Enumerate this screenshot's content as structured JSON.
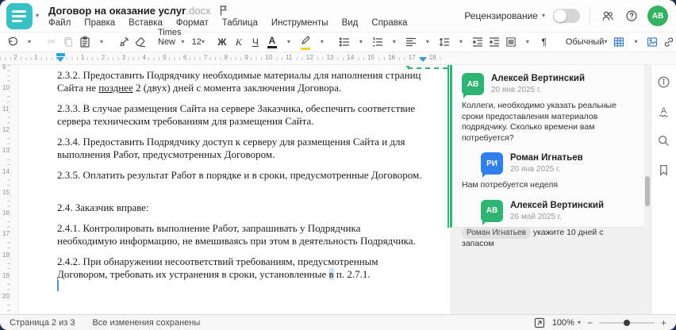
{
  "header": {
    "doc_title": "Договор на оказание услуг",
    "doc_ext": ".docx",
    "menu": [
      "Файл",
      "Правка",
      "Вставка",
      "Формат",
      "Таблица",
      "Инструменты",
      "Вид",
      "Справка"
    ],
    "review_label": "Рецензирование",
    "avatar_initials": "АВ"
  },
  "toolbar": {
    "font_name": "Times New ...",
    "font_size": "12",
    "bold_label": "Ж",
    "italic_label": "К",
    "underline_label": "Ч",
    "font_color_label": "А",
    "style_name": "Обычный",
    "pilcrow": "¶",
    "more_label": "···",
    "caret": "▾",
    "cut_glyph": "✂"
  },
  "ruler": {
    "h_left": [
      "2",
      "1"
    ],
    "h_right": [
      "1",
      "2",
      "3",
      "4",
      "5",
      "6",
      "7",
      "8",
      "9",
      "10",
      "11",
      "12",
      "13",
      "14",
      "15",
      "16",
      "17",
      "18"
    ],
    "v": [
      "9",
      "10",
      "11",
      "12",
      "13",
      "14",
      "15",
      "16",
      "17",
      "18",
      "19",
      "20"
    ]
  },
  "document": {
    "p232_a": "2.3.2. Предоставить Подрядчику необходимые материалы для наполнения страниц Сайта не ",
    "p232_u": "позднее",
    "p232_b": " 2 (двух) дней с момента заключения Договора.",
    "p233": "2.3.3. В случае размещения Сайта на сервере Заказчика, обеспечить соответствие сервера техническим требованиям для размещения Сайта.",
    "p234": "2.3.4. Предоставить Подрядчику доступ к серверу для размещения Сайта и для выполнения Работ, предусмотренных Договором.",
    "p235": "2.3.5. Оплатить результат Работ в порядке и в сроки, предусмотренные Договором.",
    "p24": "2.4. Заказчик вправе:",
    "p241": "2.4.1. Контролировать выполнение Работ, запрашивать у Подрядчика необходимую информацию, не вмешиваясь при этом в деятельность Подрядчика.",
    "p242_a": "2.4.2. При обнаружении несоответствий требованиям, предусмотренным Договором, требовать их устранения в сроки, установленные ",
    "p242_hl": "в",
    "p242_b": " п. 2.7.1."
  },
  "comments": {
    "thread": [
      {
        "initials": "АВ",
        "name": "Алексей Вертинский",
        "date": "20 янв 2025 г.",
        "text": "Коллеги, необходимо указать реальные сроки предоставления материалов подрядчику. Сколько времени вам потребуется?"
      },
      {
        "initials": "РИ",
        "name": "Роман Игнатьев",
        "date": "20 янв 2025 г.",
        "text": "Нам потребуется неделя"
      },
      {
        "initials": "АВ",
        "name": "Алексей Вертинский",
        "date": "26 май 2025 г.",
        "mention": "Роман Игнатьев",
        "text": " укажите 10 дней с запасом"
      }
    ]
  },
  "statusbar": {
    "page_label": "Страница 2 из 3",
    "saved_label": "Все изменения сохранены",
    "zoom_value": "100%"
  },
  "colors": {
    "accent_teal": "#38c2c6",
    "comment_green": "#2eb573",
    "comment_blue": "#2f80ed",
    "toolbar_blue": "#3b7ec2"
  }
}
